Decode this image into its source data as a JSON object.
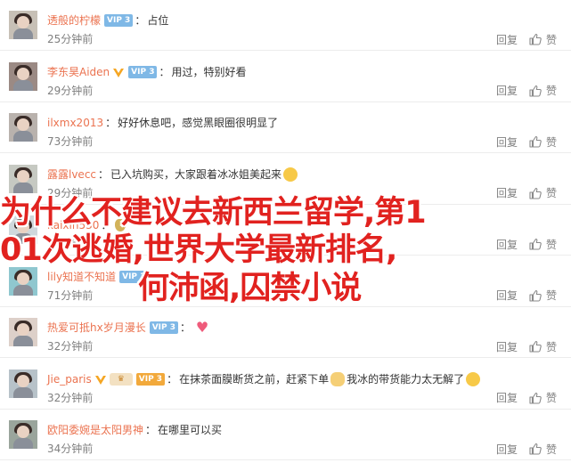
{
  "comments": [
    {
      "username": "透般的柠檬",
      "vip": "VIP 3",
      "vip_gold": false,
      "badge": "",
      "content": "占位",
      "emoji": "",
      "time": "25分钟前",
      "reply": "回复",
      "like": "赞",
      "avatar_color": "#c7c0b6"
    },
    {
      "username": "李东昊Aiden",
      "vip": "VIP 3",
      "vip_gold": false,
      "badge": "v",
      "content": "用过，特别好看",
      "emoji": "",
      "time": "29分钟前",
      "reply": "回复",
      "like": "赞",
      "avatar_color": "#9b8a84"
    },
    {
      "username": "ilxmx2013",
      "vip": "",
      "vip_gold": false,
      "badge": "",
      "content": "好好休息吧，感觉黑眼圈很明显了",
      "emoji": "",
      "time": "73分钟前",
      "reply": "回复",
      "like": "赞",
      "avatar_color": "#b9b2ad"
    },
    {
      "username": "露露lvecc",
      "vip": "",
      "vip_gold": false,
      "badge": "",
      "content": "已入坑购买，大家跟着冰冰姐美起来",
      "emoji": "grin",
      "time": "29分钟前",
      "reply": "回复",
      "like": "赞",
      "avatar_color": "#c6c9c2"
    },
    {
      "username": "kaixin530",
      "vip": "",
      "vip_gold": false,
      "badge": "",
      "content": "",
      "emoji": "bag",
      "time": "71分钟前",
      "reply": "回复",
      "like": "赞",
      "avatar_color": "#cfd8dc"
    },
    {
      "username": "lily知道不知道",
      "vip": "VIP 3",
      "vip_gold": false,
      "badge": "",
      "content": "",
      "emoji": "",
      "time": "71分钟前",
      "reply": "回复",
      "like": "赞",
      "avatar_color": "#8fc7cf"
    },
    {
      "username": "热爱可抵hx岁月漫长",
      "vip": "VIP 3",
      "vip_gold": false,
      "badge": "",
      "content": "",
      "emoji": "heart",
      "time": "32分钟前",
      "reply": "回复",
      "like": "赞",
      "avatar_color": "#ddd0c9"
    },
    {
      "username": "Jie_paris",
      "vip": "VIP 3",
      "vip_gold": true,
      "badge": "crown",
      "content": "在抹茶面膜断货之前，赶紧下单",
      "content2": "我冰的带货能力太无解了",
      "emoji": "cat",
      "time": "32分钟前",
      "reply": "回复",
      "like": "赞",
      "avatar_color": "#b7c2c9"
    },
    {
      "username": "欧阳委婉是太阳男神",
      "vip": "",
      "vip_gold": false,
      "badge": "",
      "content": "在哪里可以买",
      "emoji": "",
      "time": "34分钟前",
      "reply": "回复",
      "like": "赞",
      "avatar_color": "#9aa59c"
    }
  ],
  "overlay": {
    "line1": "为什么不建议去新西兰留学,第1",
    "line2": "01次逃婚,世界大学最新排名,",
    "line3": "何沛函,囚禁小说"
  },
  "colors": {
    "username": "#eb7350",
    "overlay": "#e1221f",
    "meta": "#808080"
  }
}
